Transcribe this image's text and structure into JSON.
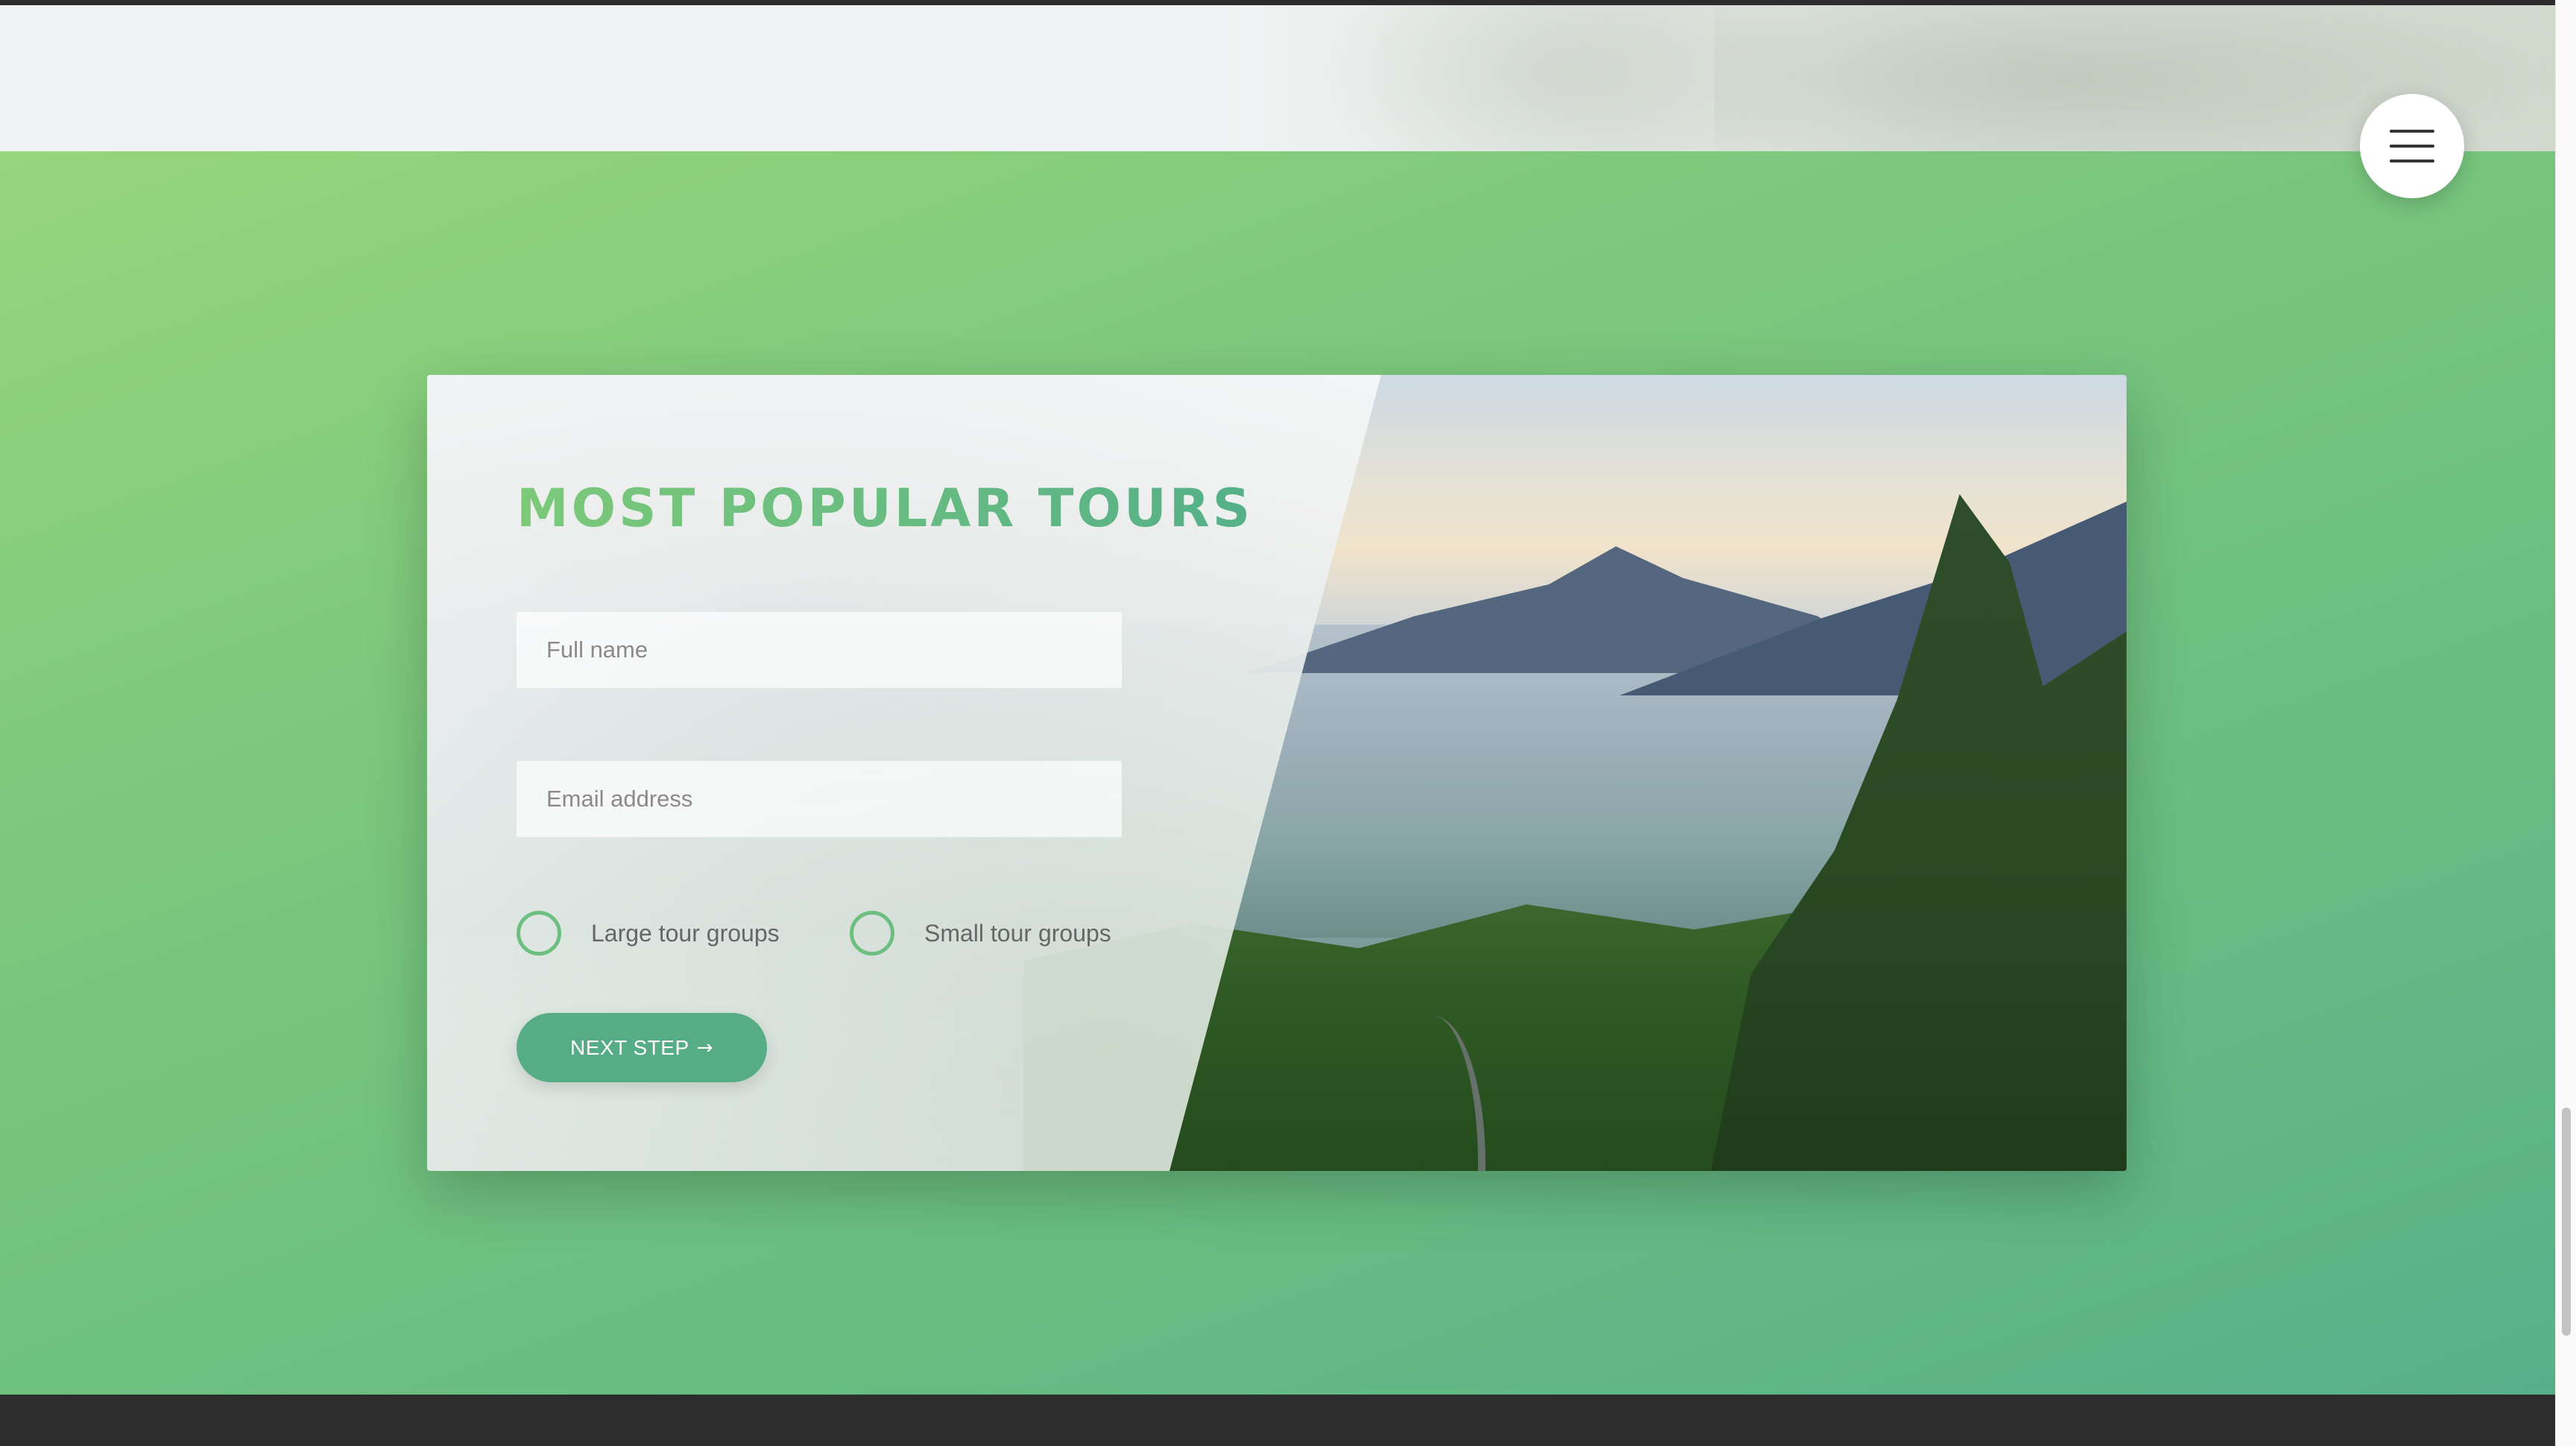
{
  "menu": {
    "icon": "hamburger-menu-icon"
  },
  "booking": {
    "title": "MOST POPULAR TOURS",
    "fields": {
      "full_name_placeholder": "Full name",
      "email_placeholder": "Email address"
    },
    "radios": [
      {
        "label": "Large tour groups",
        "checked": false
      },
      {
        "label": "Small tour groups",
        "checked": false
      }
    ],
    "next_button": {
      "label": "NEXT STEP",
      "icon": "→"
    }
  },
  "colors": {
    "accent_green": "#56ac84",
    "title_gradient_start": "#7cc97a",
    "title_gradient_end": "#55b088",
    "section_bg_start": "#96d67c",
    "section_bg_end": "#58b08a",
    "footer": "#2d2d2d"
  }
}
